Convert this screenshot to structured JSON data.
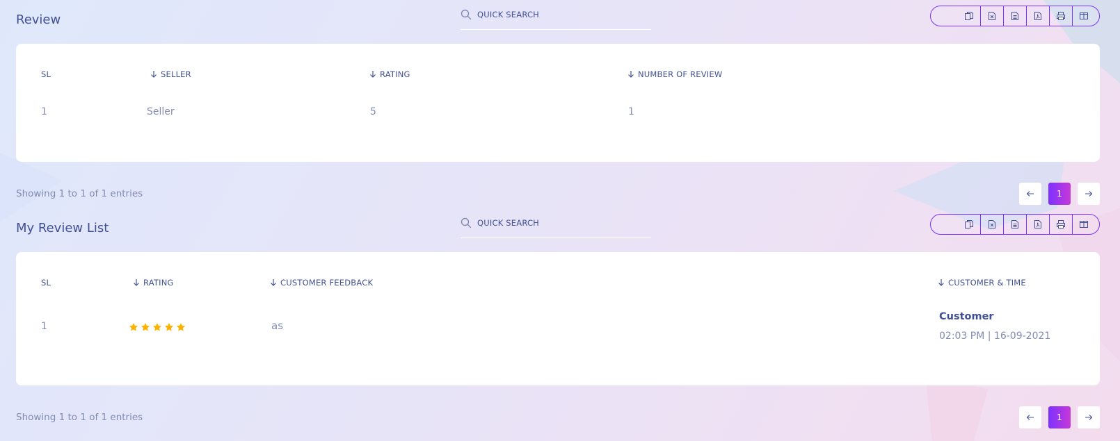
{
  "colors": {
    "accent": "#7c32ff",
    "accent2": "#c738d8",
    "heading": "#415094",
    "muted": "#828bb2",
    "star": "#ffb100"
  },
  "review": {
    "title": "Review",
    "search_placeholder": "QUICK SEARCH",
    "export_icons": [
      "copy-icon",
      "excel-icon",
      "csv-icon",
      "pdf-icon",
      "print-icon",
      "columns-icon"
    ],
    "columns": [
      "SL",
      "SELLER",
      "RATING",
      "NUMBER OF REVIEW"
    ],
    "rows": [
      {
        "sl": "1",
        "seller": "Seller",
        "rating": "5",
        "number_of_review": "1"
      }
    ],
    "info": "Showing 1 to 1 of 1 entries",
    "page": "1"
  },
  "my_review_list": {
    "title": "My Review List",
    "search_placeholder": "QUICK SEARCH",
    "export_icons": [
      "copy-icon",
      "excel-icon",
      "csv-icon",
      "pdf-icon",
      "print-icon",
      "columns-icon"
    ],
    "columns": [
      "SL",
      "RATING",
      "CUSTOMER FEEDBACK",
      "CUSTOMER & TIME"
    ],
    "rows": [
      {
        "sl": "1",
        "rating": 5,
        "feedback": "as",
        "customer": "Customer",
        "time": "02:03 PM | 16-09-2021"
      }
    ],
    "info": "Showing 1 to 1 of 1 entries",
    "page": "1"
  }
}
